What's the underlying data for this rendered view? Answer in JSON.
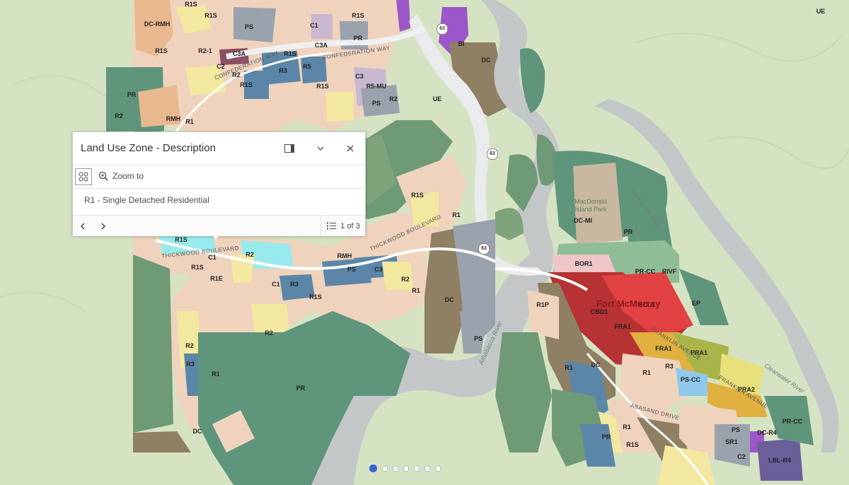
{
  "popup": {
    "title": "Land Use Zone - Description",
    "zoom_to": "Zoom to",
    "content": "R1  - Single Detached Residential",
    "pager": "1 of 3"
  },
  "slides": {
    "count": 7,
    "active": 1
  },
  "map": {
    "colors": {
      "background": "#d6e3c3",
      "park": "#5f957b",
      "river": "#c3c7c8",
      "residential_r1": "#f1d7c2",
      "residential_r2": "#f2e8a0",
      "residential_r3": "#5b86a8",
      "commercial": "#b5c5d9",
      "public": "#9aa2ad",
      "industrial": "#9d56c9",
      "downtown": "#c93232",
      "direct_control": "#8f7f63"
    },
    "zone_labels": [
      "DC-RMH",
      "R1S",
      "R1S",
      "PS",
      "C1",
      "R1S",
      "PR",
      "R1S",
      "R2-1",
      "C3A",
      "R1S",
      "C3A",
      "C2",
      "R2",
      "R3",
      "R5",
      "R1S",
      "R1S",
      "R5-MU",
      "C3",
      "R2",
      "PS",
      "UE",
      "UE",
      "BI",
      "DC",
      "PR",
      "R2",
      "RMH",
      "R1",
      "R1S",
      "R1",
      "R1S",
      "C1",
      "R1E",
      "R1S",
      "RMH",
      "R2",
      "PS",
      "C3",
      "C1",
      "R3",
      "R1S",
      "R2",
      "R1",
      "DC",
      "R2",
      "R2",
      "R3",
      "R1",
      "PS",
      "PR",
      "DC",
      "DC-MI",
      "PR",
      "BOR1",
      "PR-CC",
      "RIVF",
      "CBD1",
      "SCL1",
      "EP",
      "R1P",
      "FRA1",
      "FRA1",
      "PRA1",
      "R1",
      "DC",
      "R3",
      "R1",
      "PS-CC",
      "PRA2",
      "R1",
      "R1S",
      "PR",
      "PS",
      "DC-R4",
      "SR1",
      "C2",
      "LBL-R4",
      "PR-CC"
    ],
    "road_labels": [
      "CONFEDERATION WAY",
      "CONFEDERATION WAY",
      "THICKWOOD BOULEVARD",
      "THICKWOOD BOULEVARD",
      "ABASAND DRIVE",
      "FRANKLIN AVENUE",
      "FRANKLIN AVENUE"
    ],
    "highway": "63",
    "town": "Fort McMurray",
    "park": "MacDonald Island Park",
    "rivers": [
      "Athabasca River",
      "Clearwater River",
      "Clearwater River"
    ]
  }
}
